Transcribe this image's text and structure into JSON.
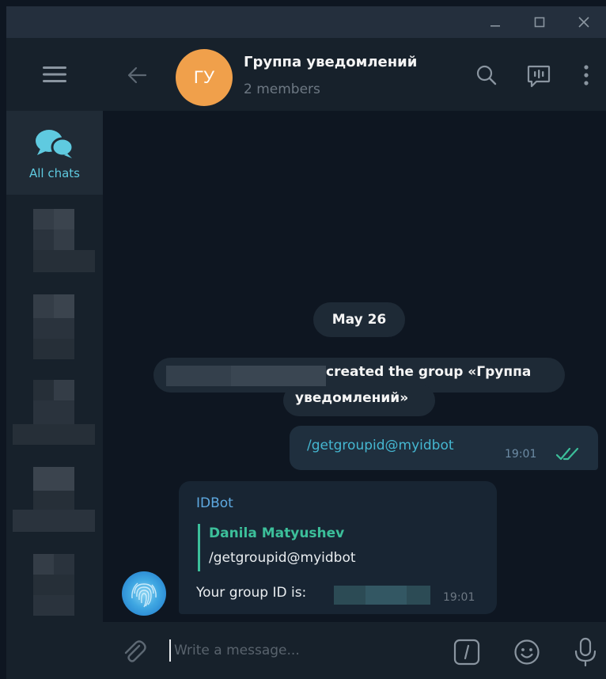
{
  "window": {
    "controls": [
      "minimize-icon",
      "maximize-icon",
      "close-icon"
    ]
  },
  "sidebar": {
    "menu_icon": "hamburger-icon",
    "folders": [
      {
        "label": "All chats",
        "icon": "chats-icon",
        "active": true
      }
    ]
  },
  "chat": {
    "title": "Группа уведомлений",
    "avatar_initials": "ГУ",
    "avatar_color": "#f0a04b",
    "subtitle": "2 members",
    "header_icons": [
      "search-icon",
      "voice-chat-icon",
      "more-vertical-icon"
    ]
  },
  "messages": {
    "date": "May 26",
    "service_line1": "created the group «Группа",
    "service_line2": "уведомлений»",
    "outgoing": {
      "text": "/getgroupid@myidbot",
      "time": "19:01",
      "status": "read"
    },
    "incoming": {
      "sender": "IDBot",
      "reply_to_name": "Danila Matyushev",
      "reply_to_text": "/getgroupid@myidbot",
      "text": "Your group ID is:",
      "time": "19:01"
    }
  },
  "composer": {
    "placeholder": "Write a message...",
    "value": "",
    "icons": [
      "attach-icon",
      "bot-command-icon",
      "emoji-icon",
      "microphone-icon"
    ]
  },
  "colors": {
    "accent": "#5fcae0",
    "sender": "#5ea9e1",
    "reply": "#3cbf9a",
    "background": "#0e1621",
    "panel": "#17212b"
  }
}
